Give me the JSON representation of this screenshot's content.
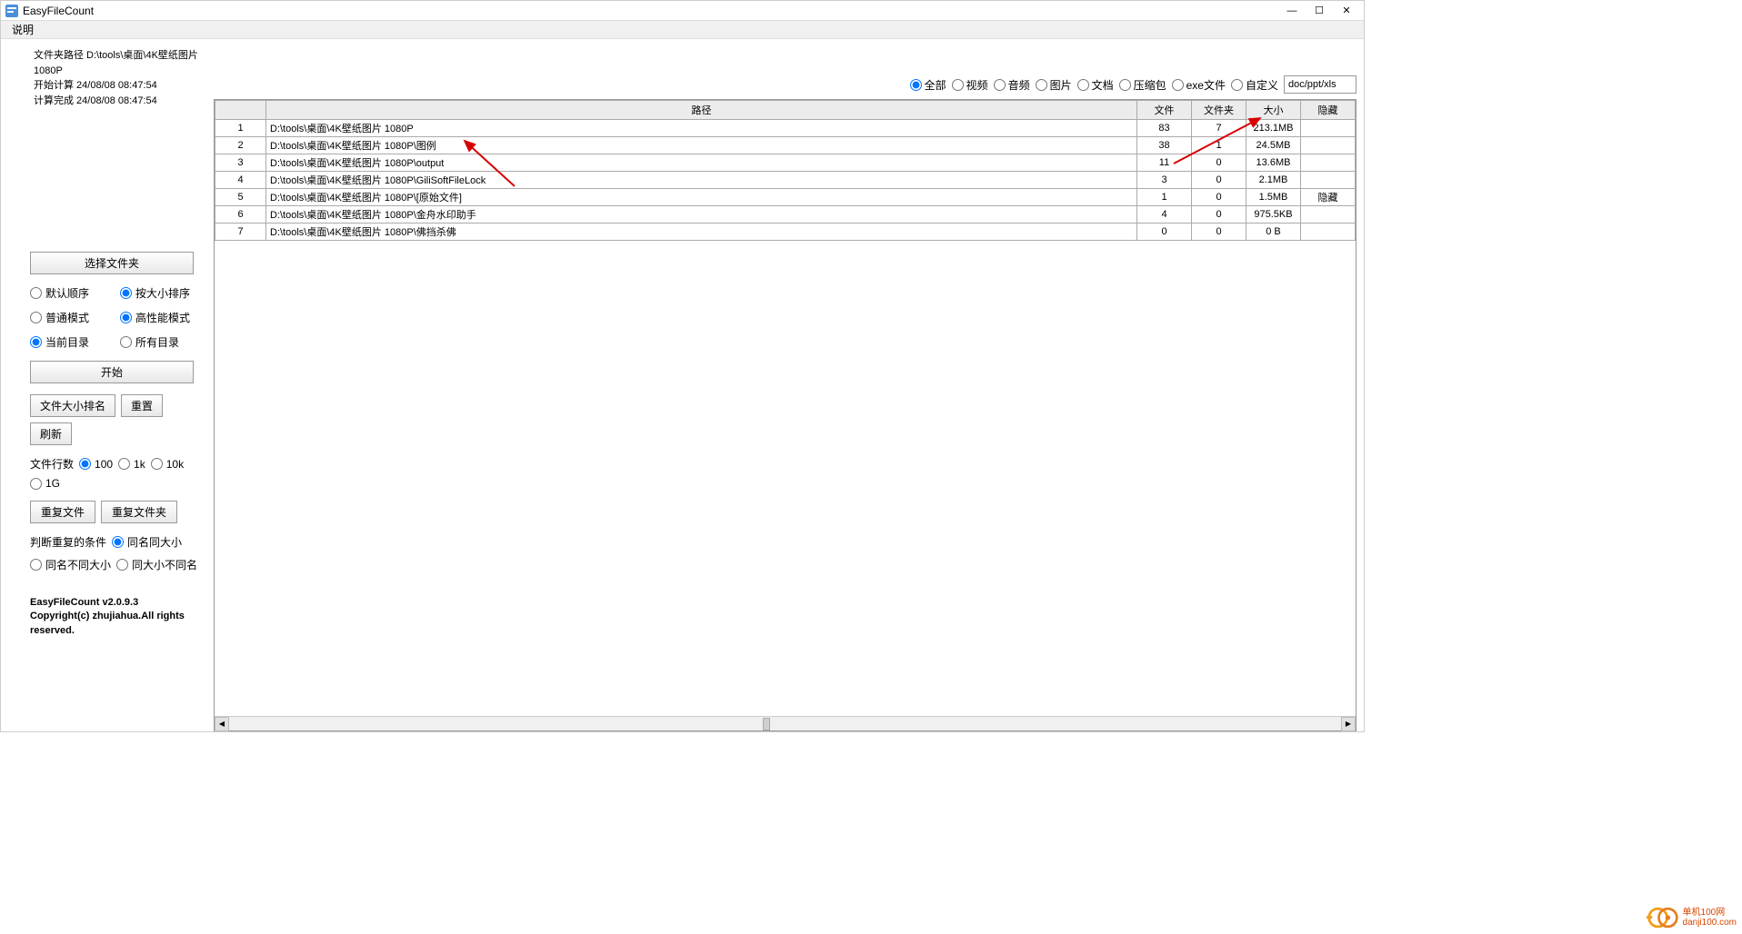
{
  "titlebar": {
    "title": "EasyFileCount"
  },
  "menubar": {
    "help": "说明"
  },
  "status": {
    "line1": "文件夹路径 D:\\tools\\桌面\\4K壁纸图片 1080P",
    "line2": "开始计算 24/08/08 08:47:54",
    "line3": "计算完成 24/08/08 08:47:54"
  },
  "buttons": {
    "select_folder": "选择文件夹",
    "start": "开始",
    "size_rank": "文件大小排名",
    "reset": "重置",
    "refresh": "刷新",
    "dup_files": "重复文件",
    "dup_folders": "重复文件夹"
  },
  "sort": {
    "default": "默认顺序",
    "by_size": "按大小排序",
    "normal_mode": "普通模式",
    "high_perf": "高性能模式",
    "current_dir": "当前目录",
    "all_dirs": "所有目录"
  },
  "rowcount": {
    "label": "文件行数",
    "r100": "100",
    "r1k": "1k",
    "r10k": "10k",
    "r1g": "1G"
  },
  "dup": {
    "label": "判断重复的条件",
    "same_name_same_size": "同名同大小",
    "same_name_diff_size": "同名不同大小",
    "same_size_diff_name": "同大小不同名"
  },
  "version": {
    "line1": "EasyFileCount v2.0.9.3",
    "line2": "Copyright(c) zhujiahua.All rights reserved."
  },
  "filters": {
    "all": "全部",
    "video": "视频",
    "audio": "音频",
    "image": "图片",
    "doc": "文档",
    "archive": "压缩包",
    "exe": "exe文件",
    "custom": "自定义",
    "custom_value": "doc/ppt/xls"
  },
  "table": {
    "headers": {
      "path": "路径",
      "files": "文件",
      "folders": "文件夹",
      "size": "大小",
      "hidden": "隐藏"
    },
    "rows": [
      {
        "n": "1",
        "path": "D:\\tools\\桌面\\4K壁纸图片 1080P",
        "files": "83",
        "folders": "7",
        "size": "213.1MB",
        "hidden": ""
      },
      {
        "n": "2",
        "path": "D:\\tools\\桌面\\4K壁纸图片 1080P\\图例",
        "files": "38",
        "folders": "1",
        "size": "24.5MB",
        "hidden": ""
      },
      {
        "n": "3",
        "path": "D:\\tools\\桌面\\4K壁纸图片 1080P\\output",
        "files": "11",
        "folders": "0",
        "size": "13.6MB",
        "hidden": ""
      },
      {
        "n": "4",
        "path": "D:\\tools\\桌面\\4K壁纸图片 1080P\\GiliSoftFileLock",
        "files": "3",
        "folders": "0",
        "size": "2.1MB",
        "hidden": ""
      },
      {
        "n": "5",
        "path": "D:\\tools\\桌面\\4K壁纸图片 1080P\\[原始文件]",
        "files": "1",
        "folders": "0",
        "size": "1.5MB",
        "hidden": "隐藏"
      },
      {
        "n": "6",
        "path": "D:\\tools\\桌面\\4K壁纸图片 1080P\\金舟水印助手",
        "files": "4",
        "folders": "0",
        "size": "975.5KB",
        "hidden": ""
      },
      {
        "n": "7",
        "path": "D:\\tools\\桌面\\4K壁纸图片 1080P\\佛挡杀佛",
        "files": "0",
        "folders": "0",
        "size": "0 B",
        "hidden": ""
      }
    ]
  },
  "watermark": {
    "top": "单机100网",
    "bottom": "danji100.com"
  }
}
